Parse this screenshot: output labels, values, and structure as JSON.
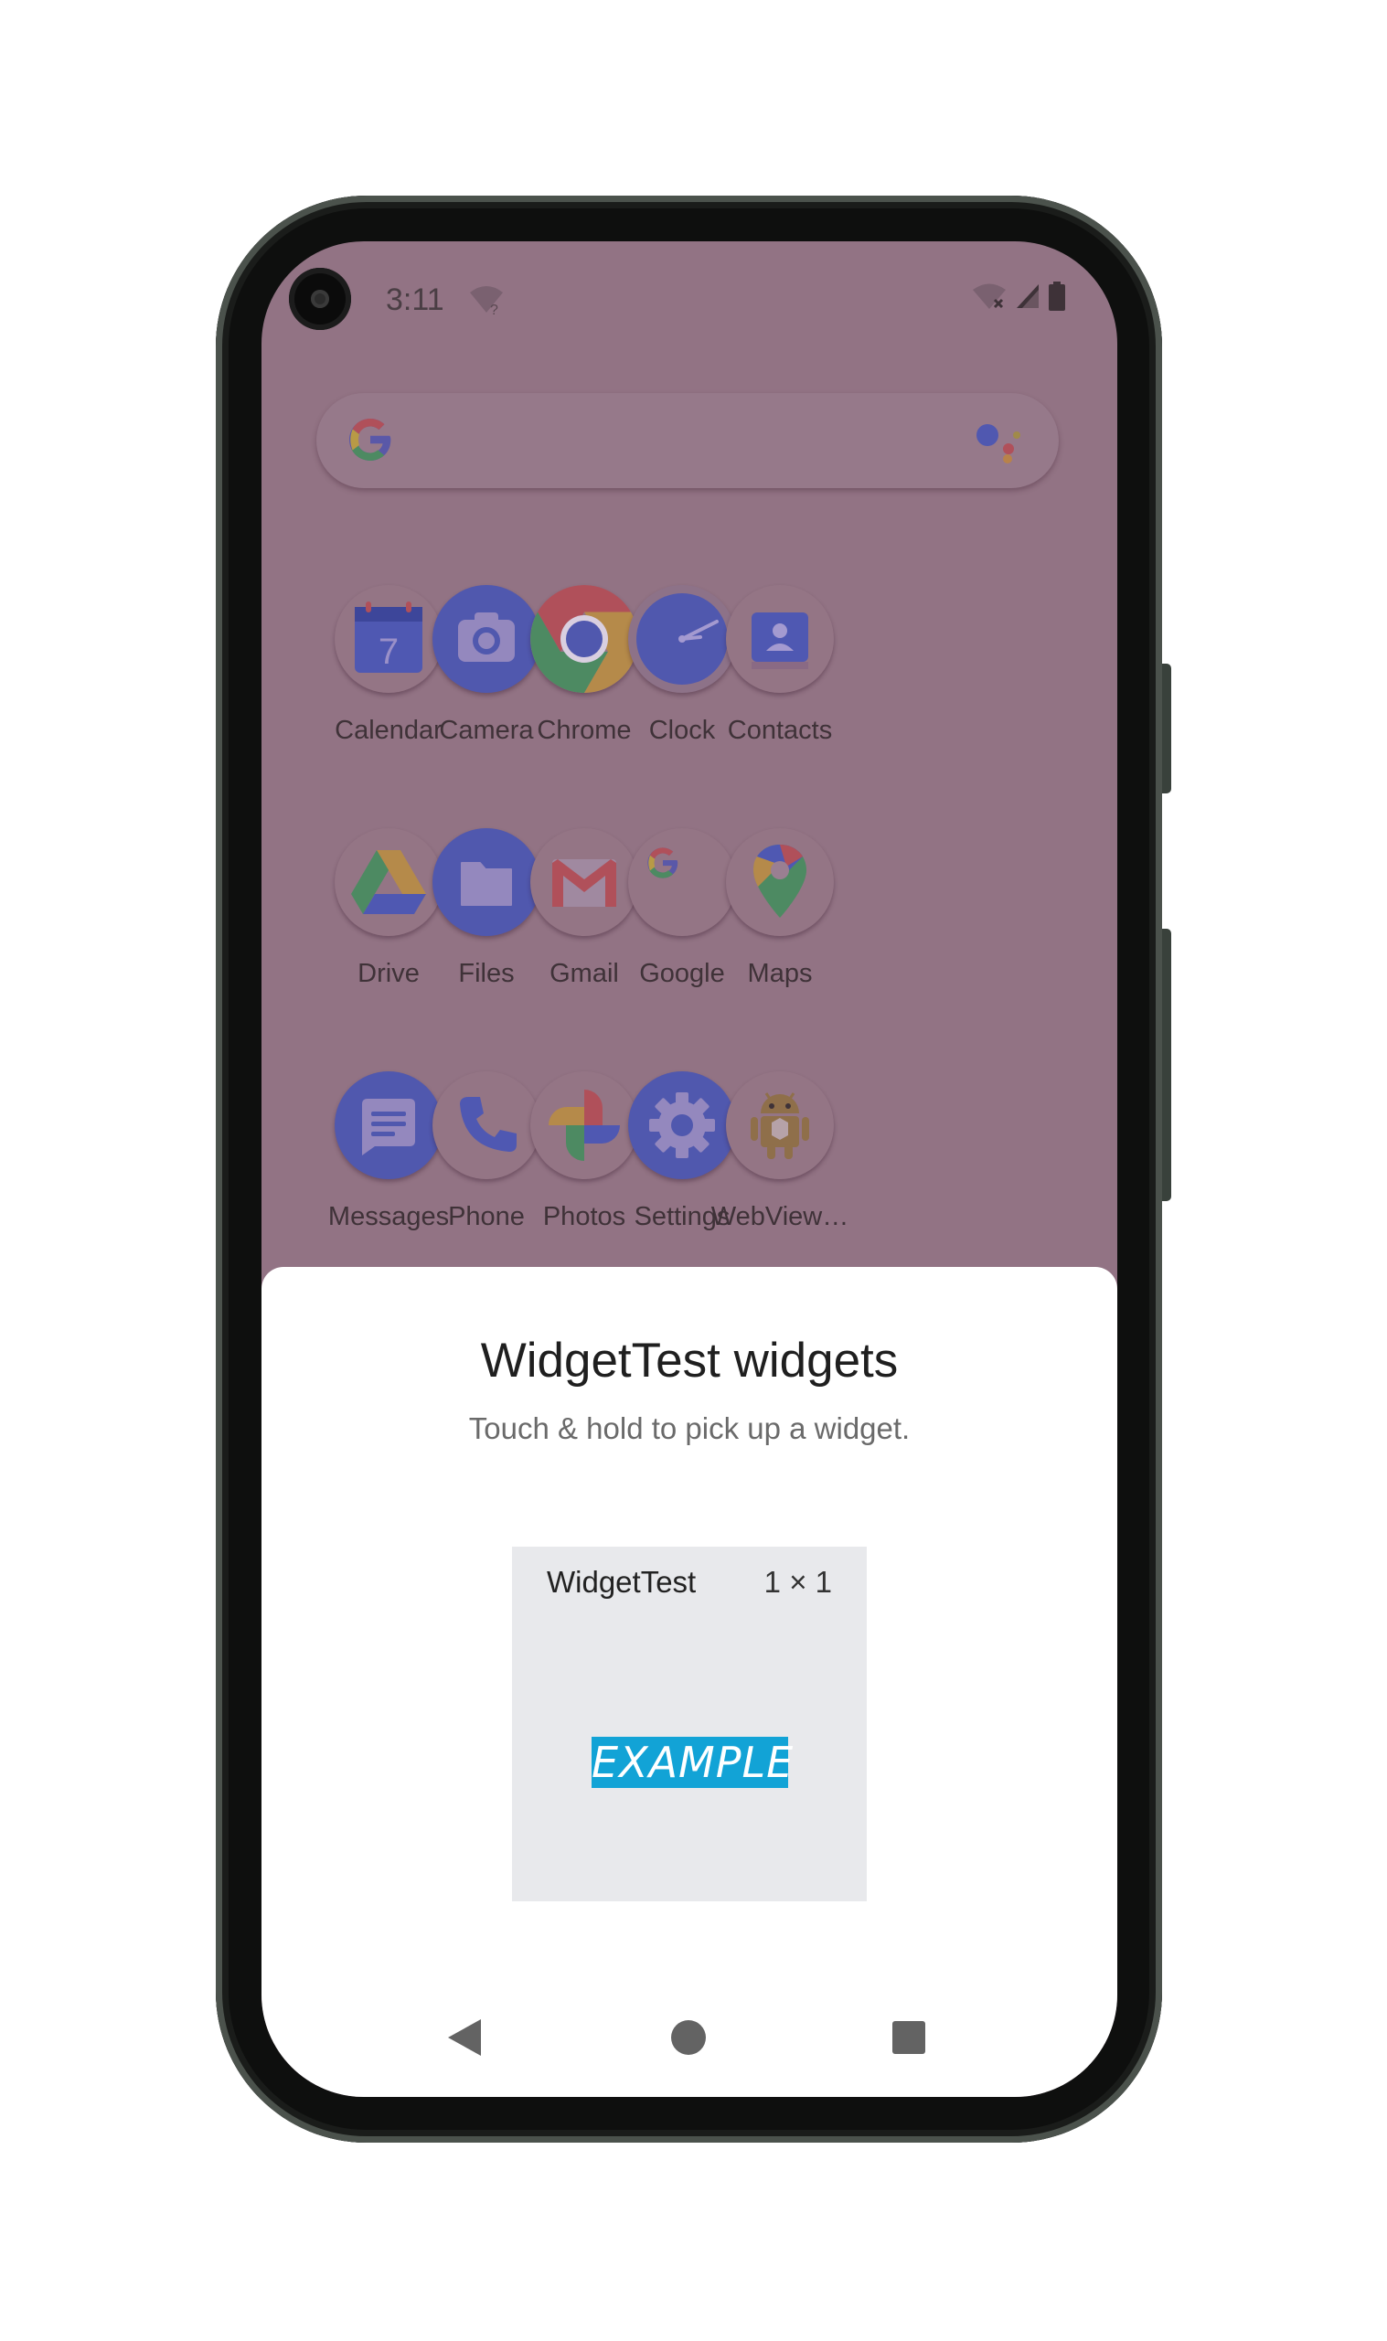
{
  "status_bar": {
    "time": "3:11"
  },
  "apps": [
    {
      "label": "Calendar",
      "icon": "calendar-icon",
      "day": "7"
    },
    {
      "label": "Camera",
      "icon": "camera-icon"
    },
    {
      "label": "Chrome",
      "icon": "chrome-icon"
    },
    {
      "label": "Clock",
      "icon": "clock-icon"
    },
    {
      "label": "Contacts",
      "icon": "contacts-icon"
    },
    {
      "label": "Drive",
      "icon": "drive-icon"
    },
    {
      "label": "Files",
      "icon": "files-icon"
    },
    {
      "label": "Gmail",
      "icon": "gmail-icon"
    },
    {
      "label": "Google",
      "icon": "google-icon"
    },
    {
      "label": "Maps",
      "icon": "maps-icon"
    },
    {
      "label": "Messages",
      "icon": "messages-icon"
    },
    {
      "label": "Phone",
      "icon": "phone-icon"
    },
    {
      "label": "Photos",
      "icon": "photos-icon"
    },
    {
      "label": "Settings",
      "icon": "settings-icon"
    },
    {
      "label": "WebView…",
      "icon": "android-icon"
    }
  ],
  "sheet": {
    "title": "WidgetTest widgets",
    "subtitle": "Touch & hold to pick up a widget.",
    "widget": {
      "name": "WidgetTest",
      "size": "1 × 1",
      "preview_text": "EXAMPLE"
    }
  },
  "colors": {
    "scrim": "#927384",
    "sheet_background": "#ffffff",
    "widget_card": "#e8e9ec",
    "preview_badge": "#12a3d6"
  }
}
